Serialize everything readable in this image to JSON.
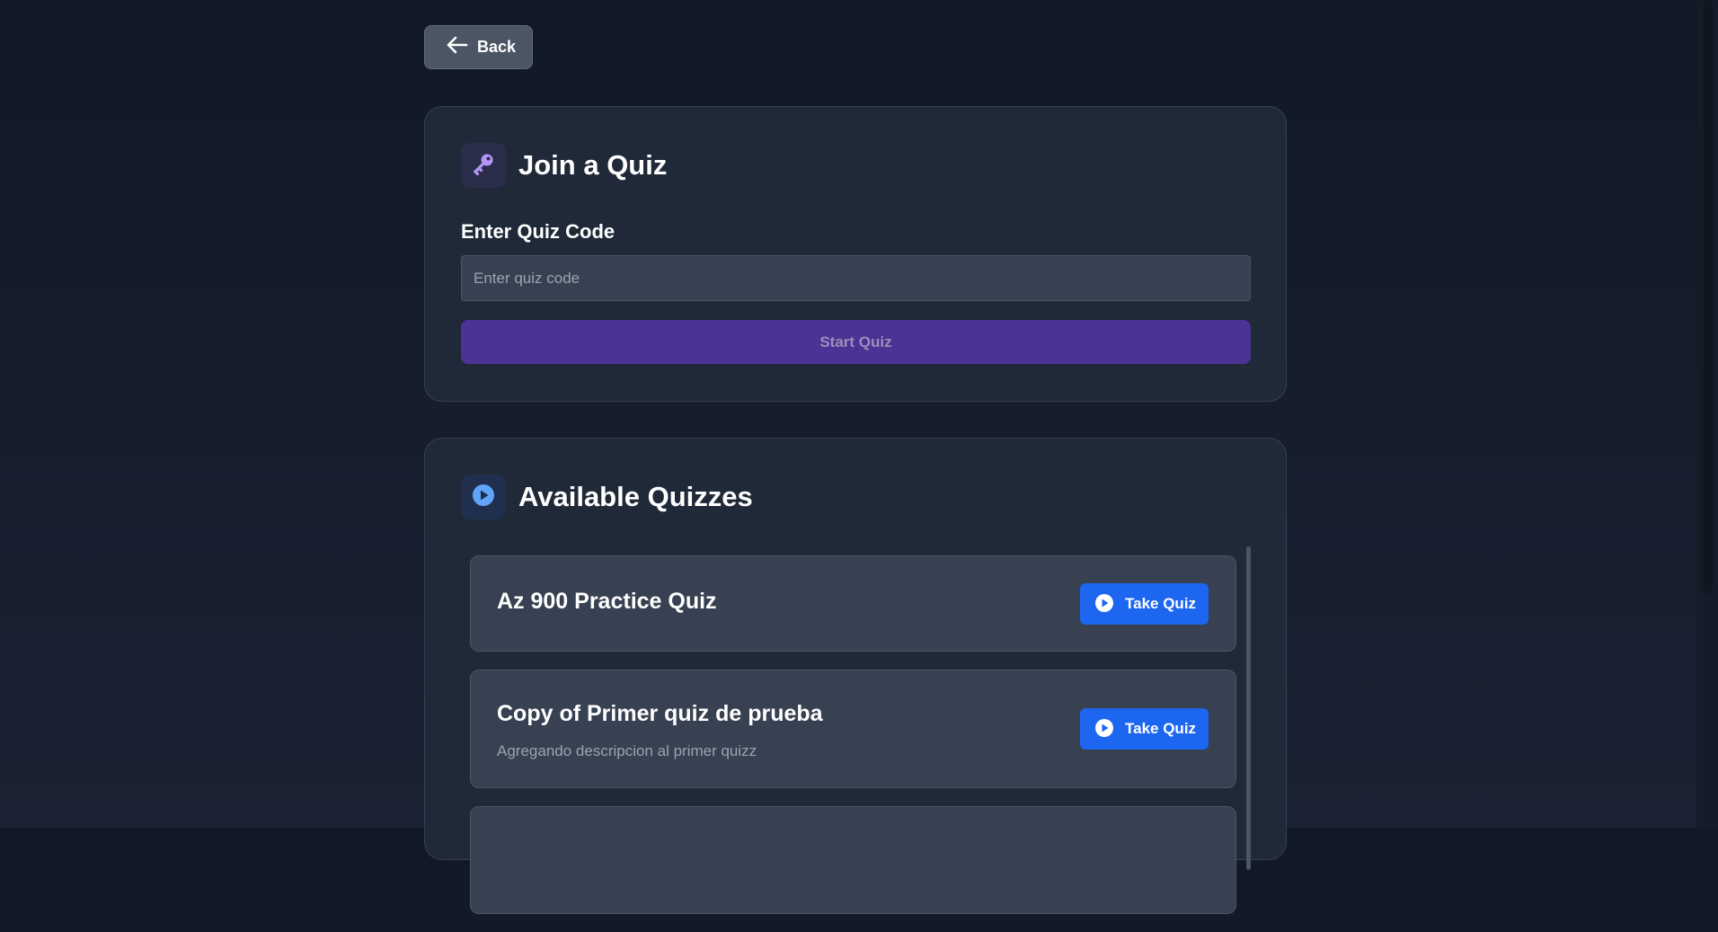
{
  "nav": {
    "back_label": "Back",
    "back_icon": "arrow-left-icon"
  },
  "join_card": {
    "title": "Join a Quiz",
    "icon": "key-icon",
    "field_label": "Enter Quiz Code",
    "code_value": "",
    "code_placeholder": "Enter quiz code",
    "start_label": "Start Quiz"
  },
  "quizzes_card": {
    "title": "Available Quizzes",
    "icon": "play-circle-icon",
    "take_label": "Take Quiz",
    "items": [
      {
        "title": "Az 900 Practice Quiz",
        "description": ""
      },
      {
        "title": "Copy of Primer quiz de prueba",
        "description": "Agregando descripcion al primer quizz"
      }
    ]
  },
  "colors": {
    "background": "#111827",
    "card": "#1f2937",
    "accent_purple": "#4c3294",
    "accent_blue": "#1d66f0",
    "key_icon": "#b794f6",
    "play_icon": "#60a5fa"
  }
}
